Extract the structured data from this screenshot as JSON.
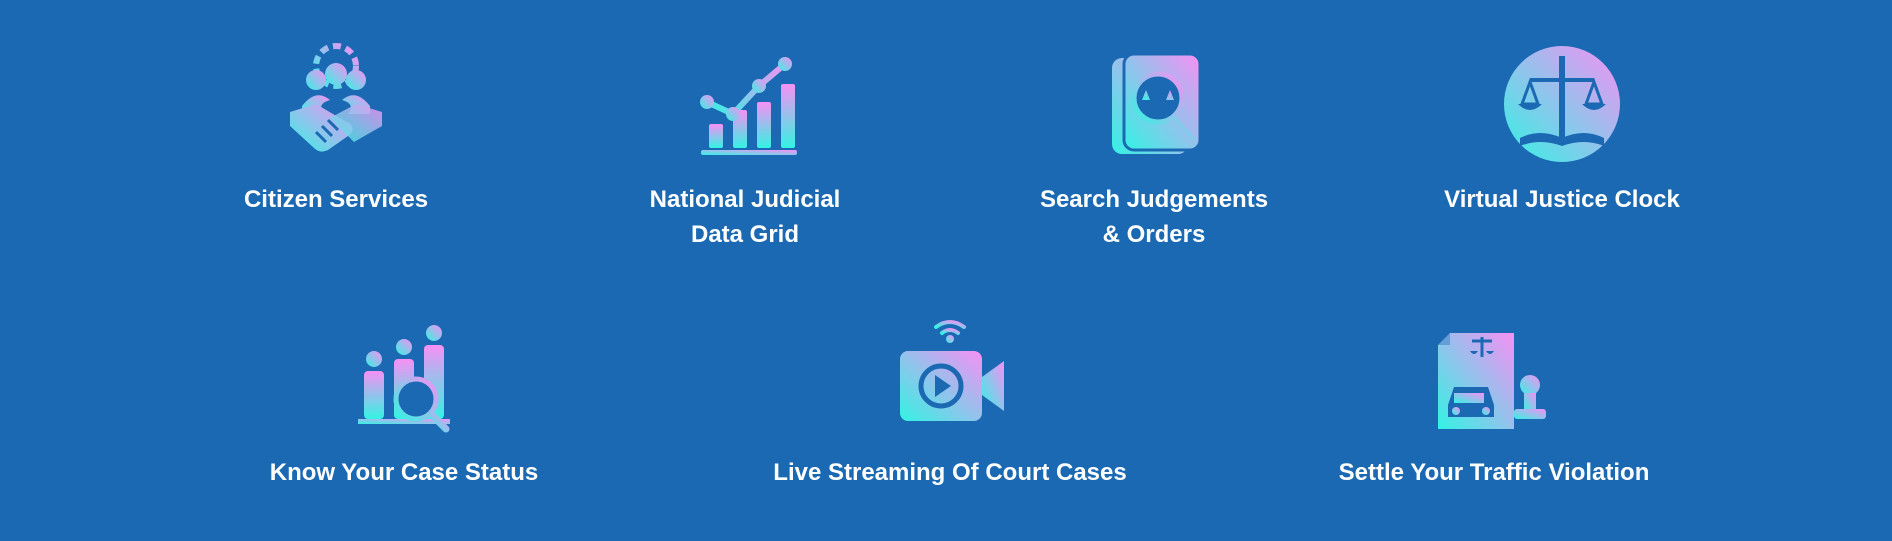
{
  "services": {
    "citizen": {
      "label": "Citizen Services",
      "icon": "citizen-services-icon"
    },
    "njdg": {
      "line1": "National Judicial",
      "line2": "Data Grid",
      "icon": "bar-chart-icon"
    },
    "judgements": {
      "line1": "Search Judgements",
      "line2": "& Orders",
      "icon": "search-document-icon"
    },
    "clock": {
      "label": "Virtual Justice Clock",
      "icon": "scales-of-justice-icon"
    },
    "case_status": {
      "label": "Know Your Case Status",
      "icon": "case-status-search-icon"
    },
    "live": {
      "label": "Live Streaming Of Court Cases",
      "icon": "video-camera-icon"
    },
    "traffic": {
      "label": "Settle Your Traffic Violation",
      "icon": "traffic-violation-icon"
    }
  },
  "colors": {
    "background": "#1b69b3",
    "gradient_start": "#33f3e4",
    "gradient_end": "#f690f4",
    "text": "#ffffff"
  }
}
